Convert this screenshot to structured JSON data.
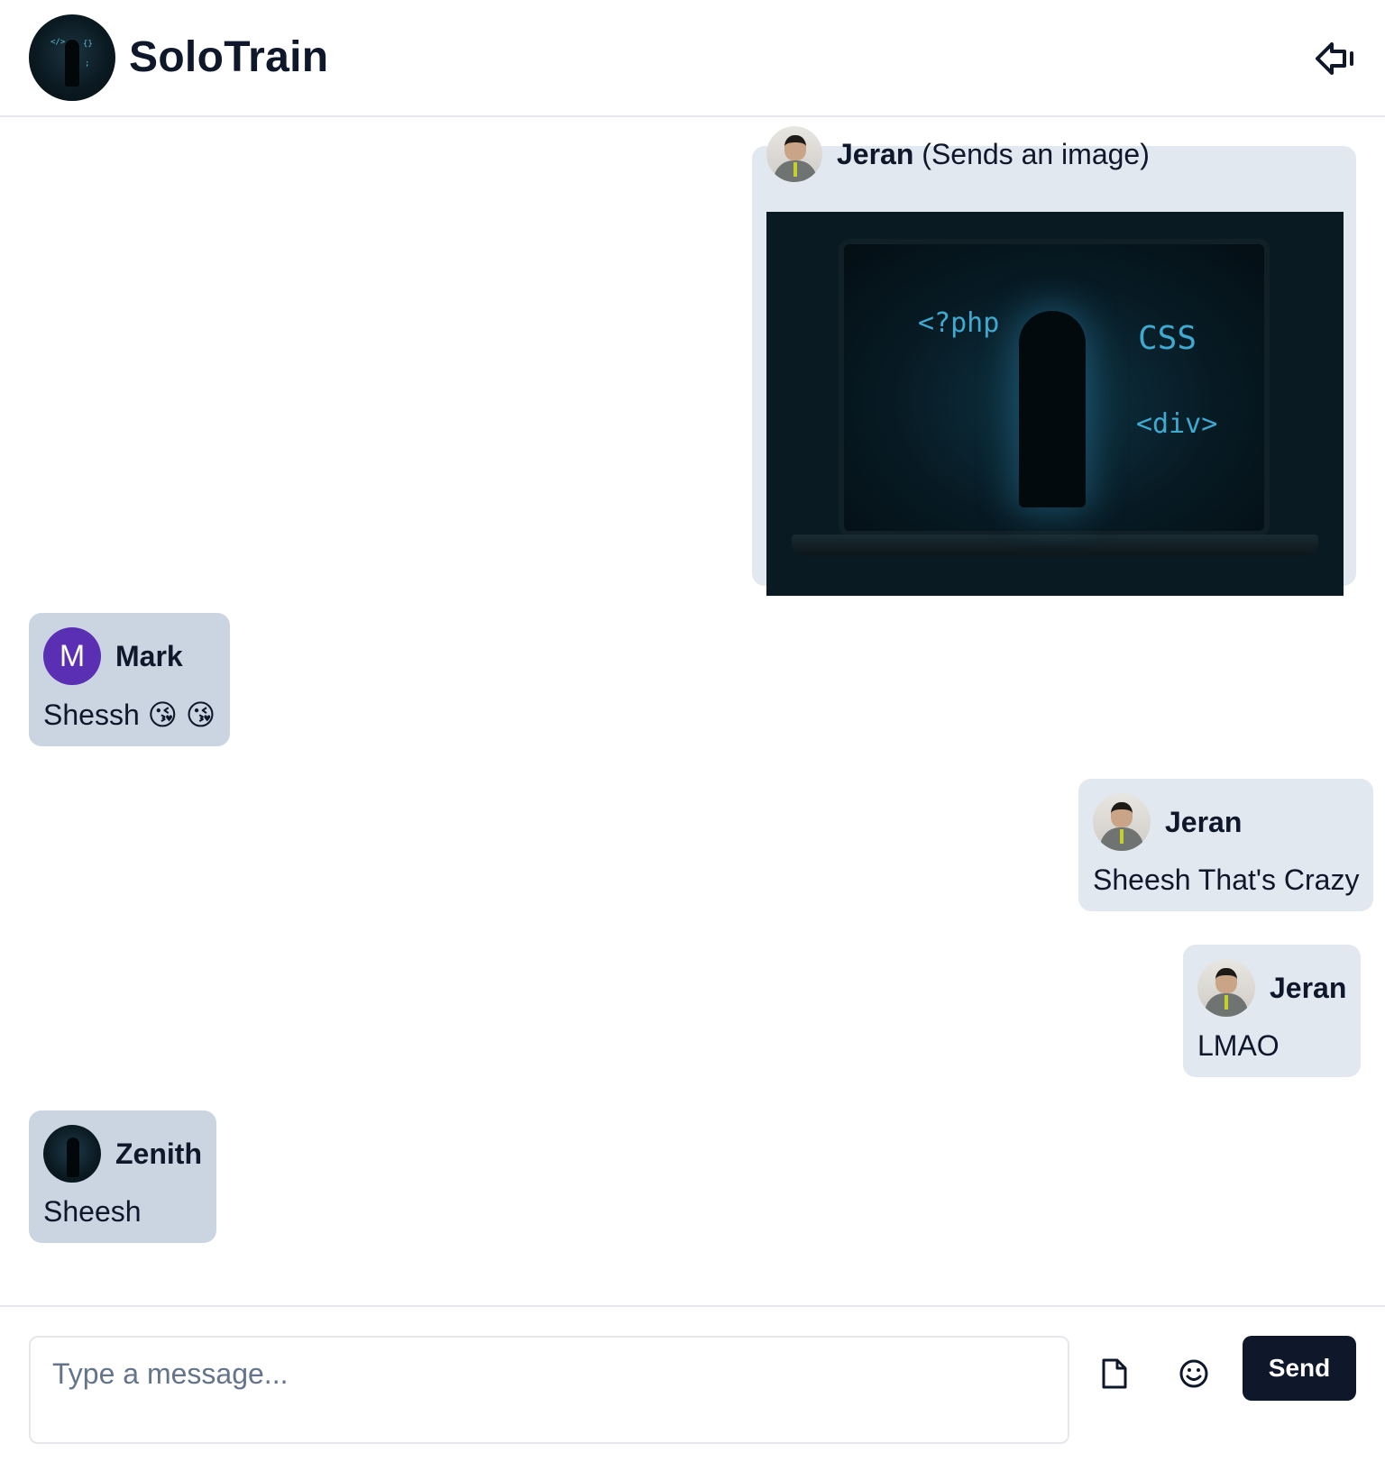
{
  "header": {
    "app_name": "SoloTrain",
    "logo_icon": "solotrain-logo",
    "logout_icon": "logout-arrow-icon"
  },
  "messages": [
    {
      "sender": "Jeran",
      "note": "(Sends an image)",
      "type": "image",
      "side": "right",
      "image": {
        "code_tags": [
          "<?php",
          "CSS",
          "<div>"
        ]
      }
    },
    {
      "sender": "Mark",
      "avatar_letter": "M",
      "text": "Shessh 😘 😘",
      "side": "left"
    },
    {
      "sender": "Jeran",
      "text": "Sheesh That's Crazy",
      "side": "right"
    },
    {
      "sender": "Jeran",
      "text": "LMAO",
      "side": "right"
    },
    {
      "sender": "Zenith",
      "text": "Sheesh",
      "side": "left"
    }
  ],
  "composer": {
    "placeholder": "Type a message...",
    "value": "",
    "attach_icon": "file-icon",
    "emoji_icon": "smiley-icon",
    "send_label": "Send"
  },
  "colors": {
    "primary": "#0f172a",
    "own_bubble": "#e2e8f0",
    "other_bubble": "#cbd5e1",
    "avatar_letter_bg": "#5b2fb3"
  }
}
